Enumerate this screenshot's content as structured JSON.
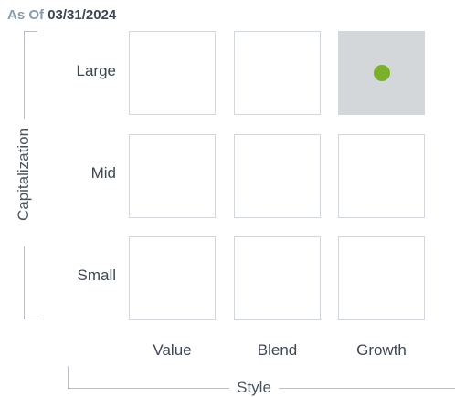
{
  "as_of": {
    "prefix": "As Of",
    "date": "03/31/2024"
  },
  "axes": {
    "vertical_label": "Capitalization",
    "horizontal_label": "Style"
  },
  "rows": [
    "Large",
    "Mid",
    "Small"
  ],
  "columns": [
    "Value",
    "Blend",
    "Growth"
  ],
  "highlight": {
    "row": "Large",
    "column": "Growth",
    "cell_color": "#d4d7da",
    "dot_color": "#7cb02c"
  },
  "colors": {
    "cell_border": "#d3d7db",
    "bracket_line": "#b9bfc5",
    "label_text": "#3d4652",
    "as_of_prefix": "#8a9ba8"
  }
}
